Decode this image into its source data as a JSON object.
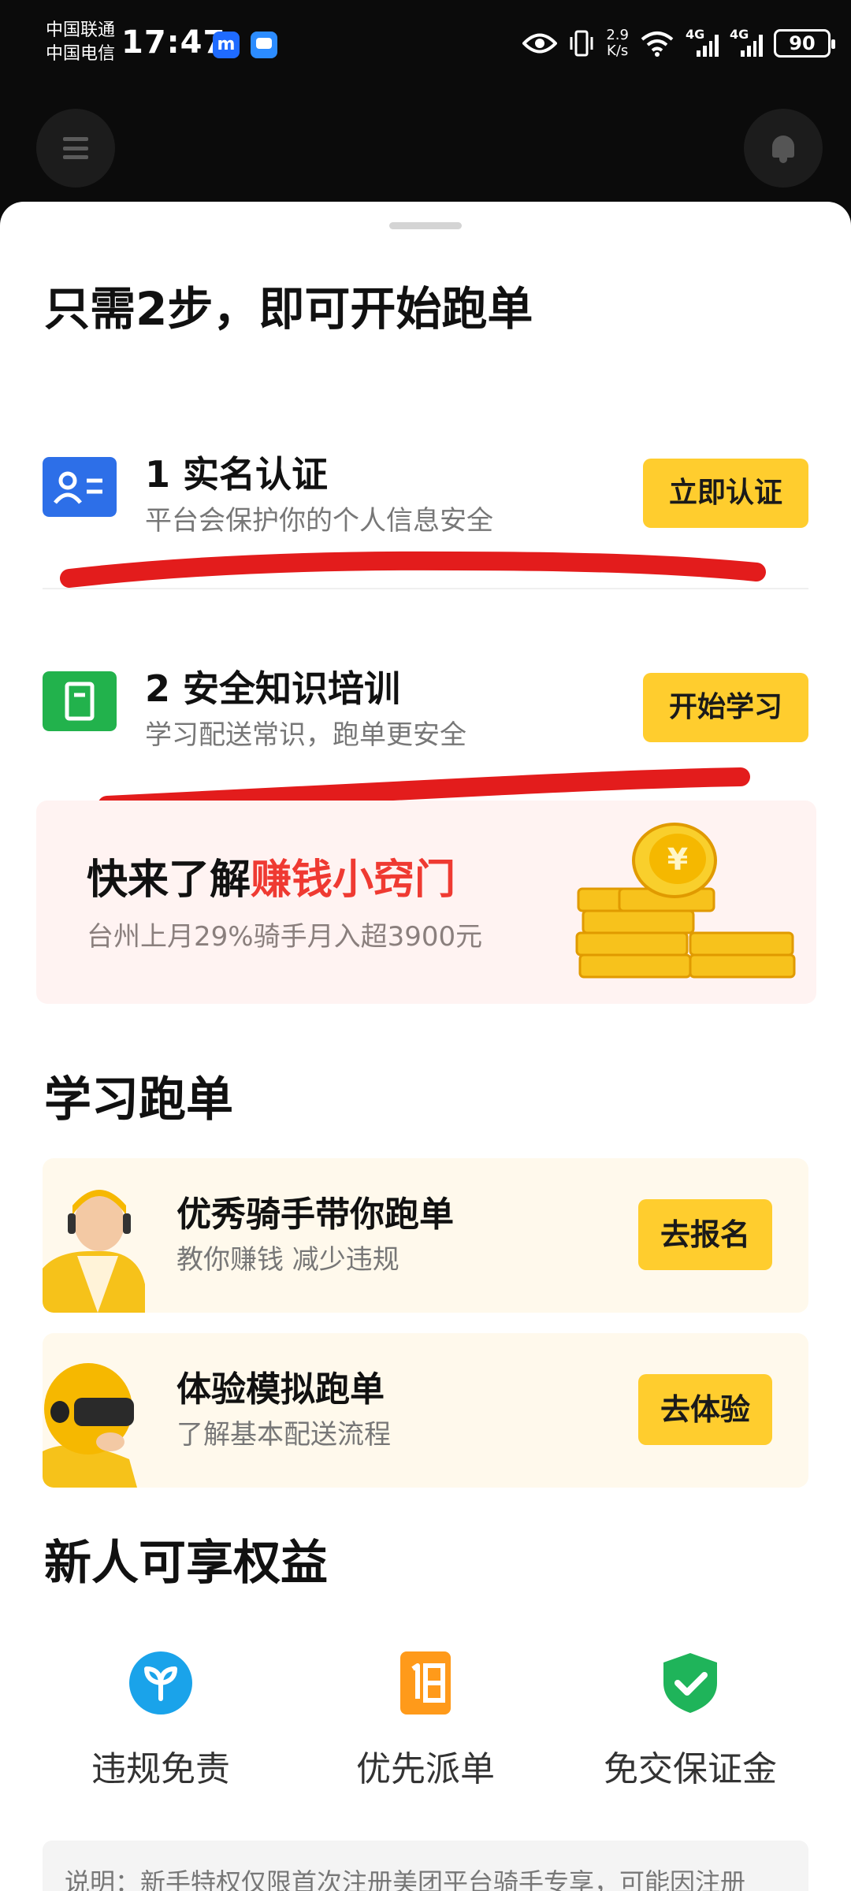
{
  "status_bar": {
    "carrier1": "中国联通",
    "carrier2": "中国电信",
    "time": "17:47",
    "app_badge": "m",
    "speed_value": "2.9",
    "speed_unit": "K/s",
    "net1": "4G",
    "net2": "4G",
    "battery": "90"
  },
  "icons": {
    "menu": "hamburger-icon",
    "bell": "bell-icon",
    "step1": "id-card-icon",
    "step2": "clipboard-icon",
    "benefit1": "sprout-icon",
    "benefit2": "list-number-icon",
    "benefit3": "shield-check-icon"
  },
  "colors": {
    "accent_yellow": "#ffcd2e",
    "highlight_red": "#ef3a32",
    "step1_blue": "#2d6fe8",
    "step2_green": "#22b24c"
  },
  "sheet": {
    "title": "只需2步，即可开始跑单",
    "steps": [
      {
        "title": "1 实名认证",
        "subtitle": "平台会保护你的个人信息安全",
        "button": "立即认证"
      },
      {
        "title": "2 安全知识培训",
        "subtitle": "学习配送常识，跑单更安全",
        "button": "开始学习"
      }
    ],
    "promo": {
      "title_prefix": "快来了解",
      "title_highlight": "赚钱小窍门",
      "subtitle": "台州上月29%骑手月入超3900元"
    },
    "learn_section_title": "学习跑单",
    "learn_cards": [
      {
        "title": "优秀骑手带你跑单",
        "subtitle": "教你赚钱 减少违规",
        "button": "去报名"
      },
      {
        "title": "体验模拟跑单",
        "subtitle": "了解基本配送流程",
        "button": "去体验"
      }
    ],
    "benefits_title": "新人可享权益",
    "benefits": [
      {
        "label": "违规免责"
      },
      {
        "label": "优先派单"
      },
      {
        "label": "免交保证金"
      }
    ],
    "note": "说明：新手特权仅限首次注册美团平台骑手专享，可能因注册"
  }
}
